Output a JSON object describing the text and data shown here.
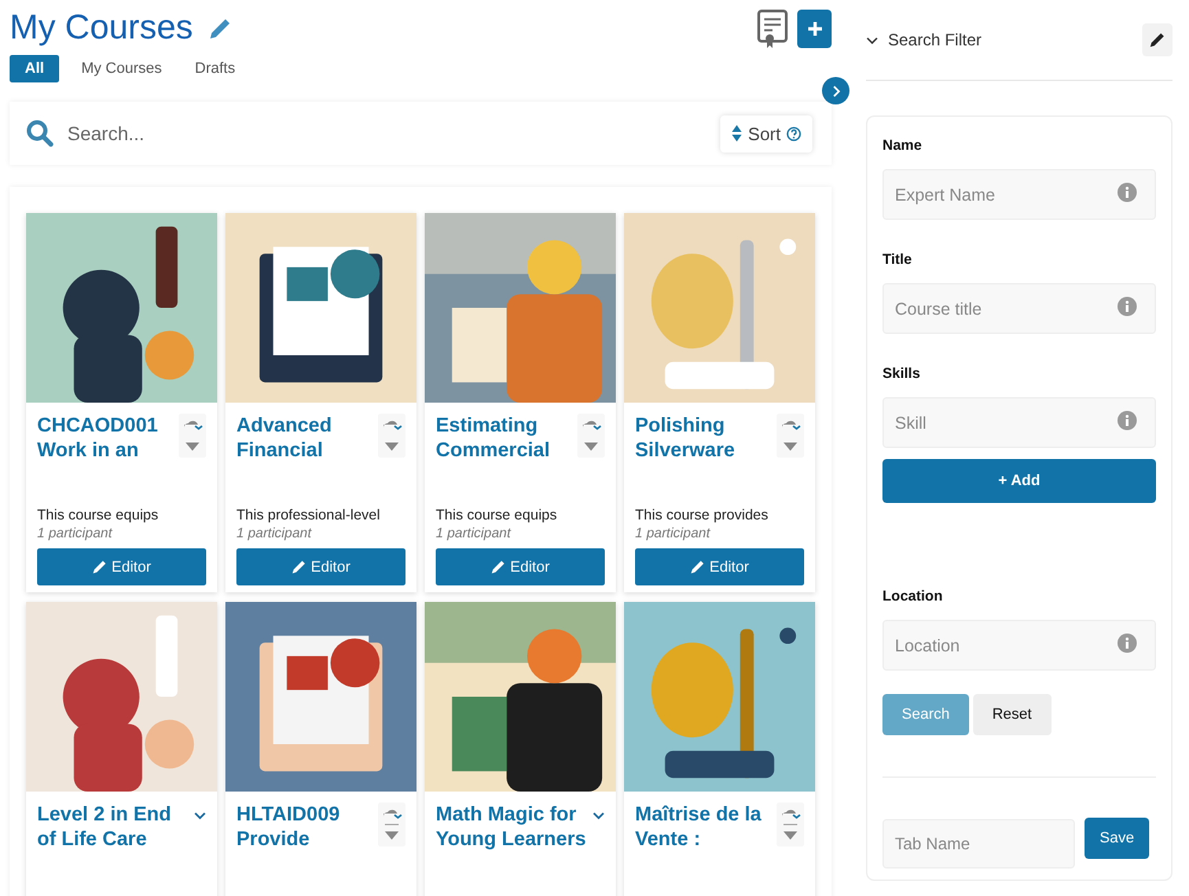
{
  "page": {
    "title": "My Courses"
  },
  "tabs": [
    {
      "label": "All",
      "selected": true
    },
    {
      "label": "My Courses",
      "selected": false
    },
    {
      "label": "Drafts",
      "selected": false
    }
  ],
  "search": {
    "placeholder": "Search...",
    "sort_label": "Sort"
  },
  "courses": [
    {
      "title": "CHCAOD001 Work in an",
      "description": "This course equips",
      "participants": "1 participant",
      "action": "Editor",
      "kind": "menu"
    },
    {
      "title": "Advanced Financial",
      "description": "This professional-level",
      "participants": "1 participant",
      "action": "Editor",
      "kind": "menu"
    },
    {
      "title": "Estimating Commercial",
      "description": "This course equips",
      "participants": "1 participant",
      "action": "Editor",
      "kind": "menu"
    },
    {
      "title": "Polishing Silverware",
      "description": "This course provides",
      "participants": "1 participant",
      "action": "Editor",
      "kind": "menu"
    },
    {
      "title": "Level 2 in End of Life Care",
      "kind": "chevron"
    },
    {
      "title": "HLTAID009 Provide",
      "kind": "menu"
    },
    {
      "title": "Math Magic for Young Learners",
      "kind": "chevron"
    },
    {
      "title": "Maîtrise de la Vente :",
      "kind": "menu"
    }
  ],
  "filter": {
    "heading": "Search Filter",
    "fields": [
      {
        "label": "Name",
        "placeholder": "Expert Name",
        "kind": "info"
      },
      {
        "label": "Title",
        "placeholder": "Course title",
        "kind": "info"
      },
      {
        "label": "Skills",
        "placeholder": "Skill",
        "kind": "info"
      }
    ],
    "add_button": "+ Add",
    "location": {
      "label": "Location",
      "placeholder": "Location"
    },
    "search_button": "Search",
    "reset_button": "Reset",
    "tab_name": {
      "placeholder": "Tab Name"
    },
    "save_button": "Save"
  }
}
